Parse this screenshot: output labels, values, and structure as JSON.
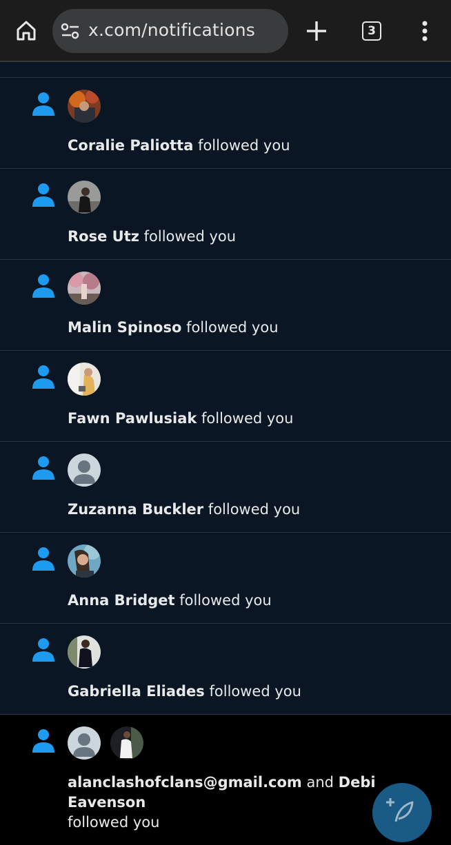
{
  "browser": {
    "url": "x.com/notifications",
    "tab_count": "3",
    "icons": [
      "home-icon",
      "site-settings-icon",
      "plus-icon",
      "tab-switcher-icon",
      "kebab-menu-icon"
    ]
  },
  "colors": {
    "accent": "#1d9bf0",
    "row_background": "#0a1623",
    "divider": "#2a3440"
  },
  "notifications": [
    {
      "name": "Coralie Paliotta",
      "action": " followed you"
    },
    {
      "name": "Rose Utz",
      "action": " followed you"
    },
    {
      "name": "Malin Spinoso",
      "action": " followed you"
    },
    {
      "name": "Fawn Pawlusiak",
      "action": " followed you"
    },
    {
      "name": "Zuzanna Buckler",
      "action": " followed you"
    },
    {
      "name": "Anna Bridget",
      "action": " followed you"
    },
    {
      "name": "Gabriella Eliades",
      "action": " followed you"
    }
  ],
  "last_notification": {
    "name1": "alanclashofclans@gmail.com",
    "conjunction": " and ",
    "name2": "Debi Eavenson",
    "action": "followed you"
  },
  "compose_button_icon": "compose-feather-icon"
}
